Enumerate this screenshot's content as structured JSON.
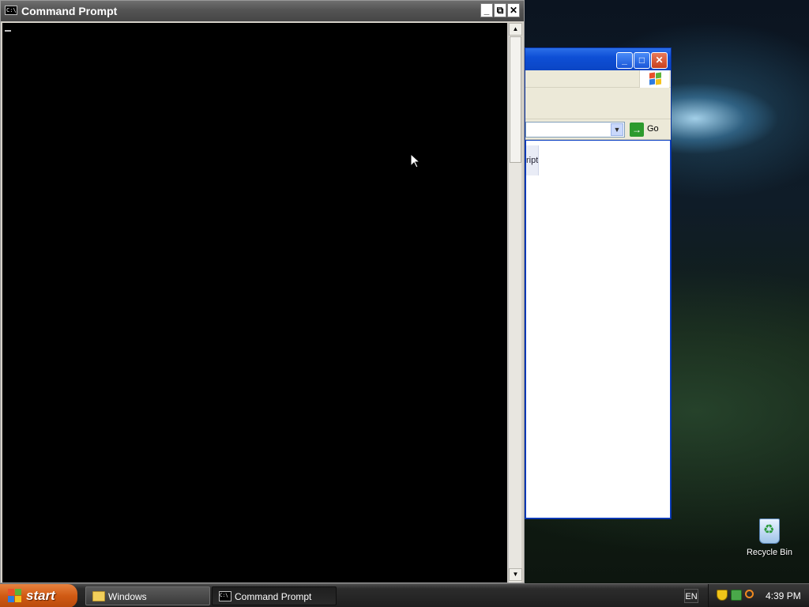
{
  "desktop": {
    "icons": [
      {
        "label": "Recycle Bin",
        "icon": "recycle-bin-icon"
      }
    ]
  },
  "explorer_window": {
    "go_label": "Go",
    "task_text": "ript"
  },
  "cmd_window": {
    "title": "Command Prompt",
    "icon_text": "C:\\",
    "buttons": {
      "minimize": "_",
      "restore": "⧉",
      "close": "✕"
    }
  },
  "taskbar": {
    "start_label": "start",
    "items": [
      {
        "label": "Windows",
        "icon": "folder-icon",
        "active": false
      },
      {
        "label": "Command Prompt",
        "icon": "cmd-icon",
        "active": true
      }
    ],
    "language": "EN",
    "clock": "4:39 PM"
  },
  "colors": {
    "taskbar": "#1f1f1f",
    "start_button": "#d05a14",
    "console_bg": "#000000",
    "explorer_title": "#0a45c4"
  }
}
